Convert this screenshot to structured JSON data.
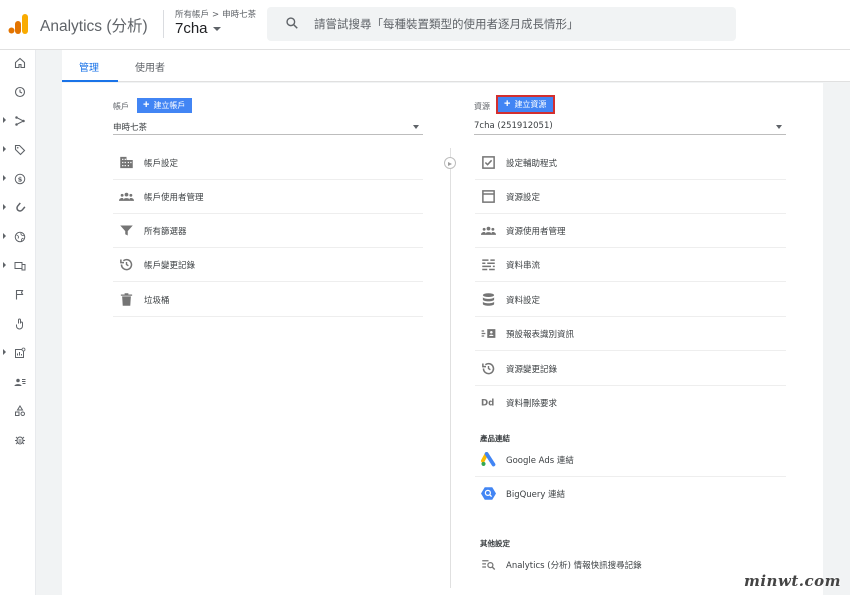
{
  "header": {
    "brand": "Analytics (分析)",
    "breadcrumb_root": "所有帳戶",
    "breadcrumb_sep": ">",
    "breadcrumb_account": "申時七茶",
    "property_name": "7cha",
    "search_placeholder": "請嘗試搜尋「每種裝置類型的使用者逐月成長情形」"
  },
  "tabs": [
    {
      "label": "管理",
      "active": true
    },
    {
      "label": "使用者",
      "active": false
    }
  ],
  "account_column": {
    "label": "帳戶",
    "create_button": "建立帳戶",
    "selected": "申時七茶",
    "items": [
      {
        "icon": "building-icon",
        "label": "帳戶設定"
      },
      {
        "icon": "people-icon",
        "label": "帳戶使用者管理"
      },
      {
        "icon": "filter-icon",
        "label": "所有篩選器"
      },
      {
        "icon": "history-icon",
        "label": "帳戶變更記錄"
      },
      {
        "icon": "trash-icon",
        "label": "垃圾桶"
      }
    ]
  },
  "property_column": {
    "label": "資源",
    "create_button": "建立資源",
    "selected": "7cha (251912051)",
    "items": [
      {
        "icon": "checkbox-icon",
        "label": "設定輔助程式"
      },
      {
        "icon": "window-icon",
        "label": "資源設定"
      },
      {
        "icon": "people-icon",
        "label": "資源使用者管理"
      },
      {
        "icon": "stream-icon",
        "label": "資料串流"
      },
      {
        "icon": "database-icon",
        "label": "資料設定"
      },
      {
        "icon": "id-card-icon",
        "label": "預設報表識別資訊"
      },
      {
        "icon": "history-icon",
        "label": "資源變更記錄"
      },
      {
        "icon": "dd-icon",
        "label": "資料刪除要求"
      }
    ],
    "product_links_title": "產品連結",
    "product_links": [
      {
        "icon": "google-ads-icon",
        "label": "Google Ads 連結"
      },
      {
        "icon": "bigquery-icon",
        "label": "BigQuery 連結"
      }
    ],
    "other_settings_title": "其他設定",
    "other_settings": [
      {
        "icon": "search-list-icon",
        "label": "Analytics (分析) 情報快訊搜尋記錄"
      }
    ]
  },
  "watermark": "minwt.com",
  "colors": {
    "accent": "#1a73e8",
    "button": "#4285f4",
    "highlight": "#d32f2f",
    "logo_orange": "#f9ab00",
    "logo_dark_orange": "#e37400"
  }
}
